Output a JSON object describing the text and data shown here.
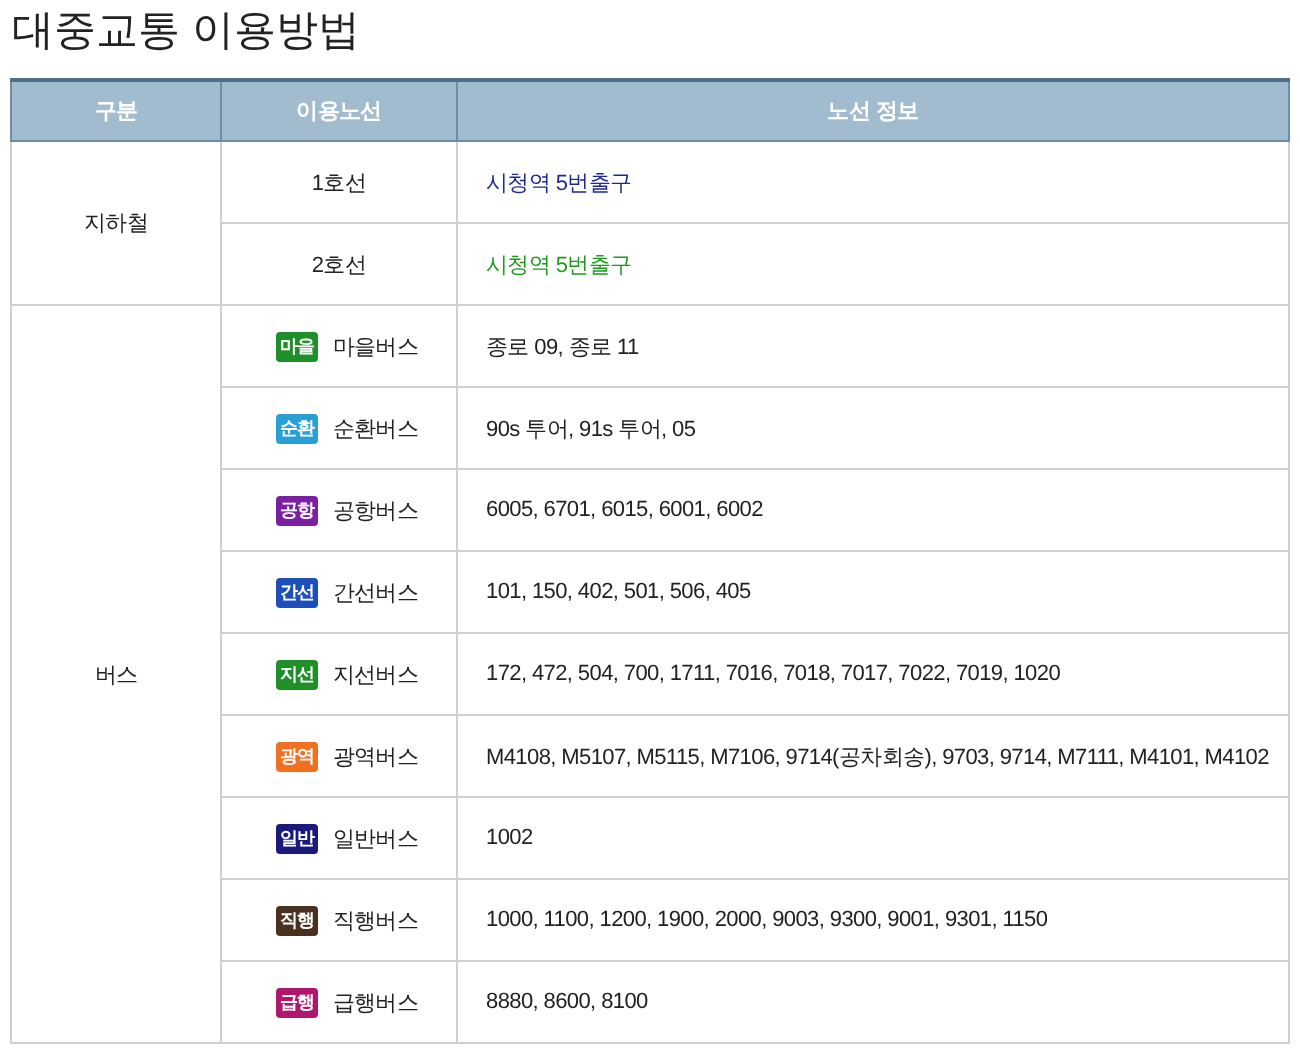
{
  "title": "대중교통 이용방법",
  "table": {
    "columns": [
      "구분",
      "이용노선",
      "노선 정보"
    ],
    "groups": [
      {
        "category": "지하철",
        "rows": [
          {
            "kind": "line",
            "route": "1호선",
            "info": "시청역 5번출구",
            "color": "#1c2a8c"
          },
          {
            "kind": "line",
            "route": "2호선",
            "info": "시청역 5번출구",
            "color": "#1e9a1e"
          }
        ]
      },
      {
        "category": "버스",
        "rows": [
          {
            "kind": "bus",
            "badge": "마을",
            "route": "마을버스",
            "info": "종로 09, 종로 11",
            "color": "#1f8f2a"
          },
          {
            "kind": "bus",
            "badge": "순환",
            "route": "순환버스",
            "info": "90s 투어, 91s 투어, 05",
            "color": "#2a9fd6"
          },
          {
            "kind": "bus",
            "badge": "공항",
            "route": "공항버스",
            "info": "6005, 6701, 6015, 6001, 6002",
            "color": "#7b1fa2"
          },
          {
            "kind": "bus",
            "badge": "간선",
            "route": "간선버스",
            "info": "101, 150, 402, 501, 506, 405",
            "color": "#1d4fb8"
          },
          {
            "kind": "bus",
            "badge": "지선",
            "route": "지선버스",
            "info": "172, 472, 504, 700, 1711, 7016, 7018, 7017, 7022, 7019, 1020",
            "color": "#1f8f2a"
          },
          {
            "kind": "bus",
            "badge": "광역",
            "route": "광역버스",
            "info": "M4108, M5107, M5115, M7106, 9714(공차회송), 9703, 9714, M7111, M4101, M4102",
            "color": "#f07020"
          },
          {
            "kind": "bus",
            "badge": "일반",
            "route": "일반버스",
            "info": "1002",
            "color": "#1a1a7a"
          },
          {
            "kind": "bus",
            "badge": "직행",
            "route": "직행버스",
            "info": "1000, 1100, 1200, 1900, 2000, 9003, 9300, 9001, 9301, 1150",
            "color": "#4a3020"
          },
          {
            "kind": "bus",
            "badge": "급행",
            "route": "급행버스",
            "info": "8880, 8600, 8100",
            "color": "#b0166e"
          }
        ]
      }
    ]
  }
}
